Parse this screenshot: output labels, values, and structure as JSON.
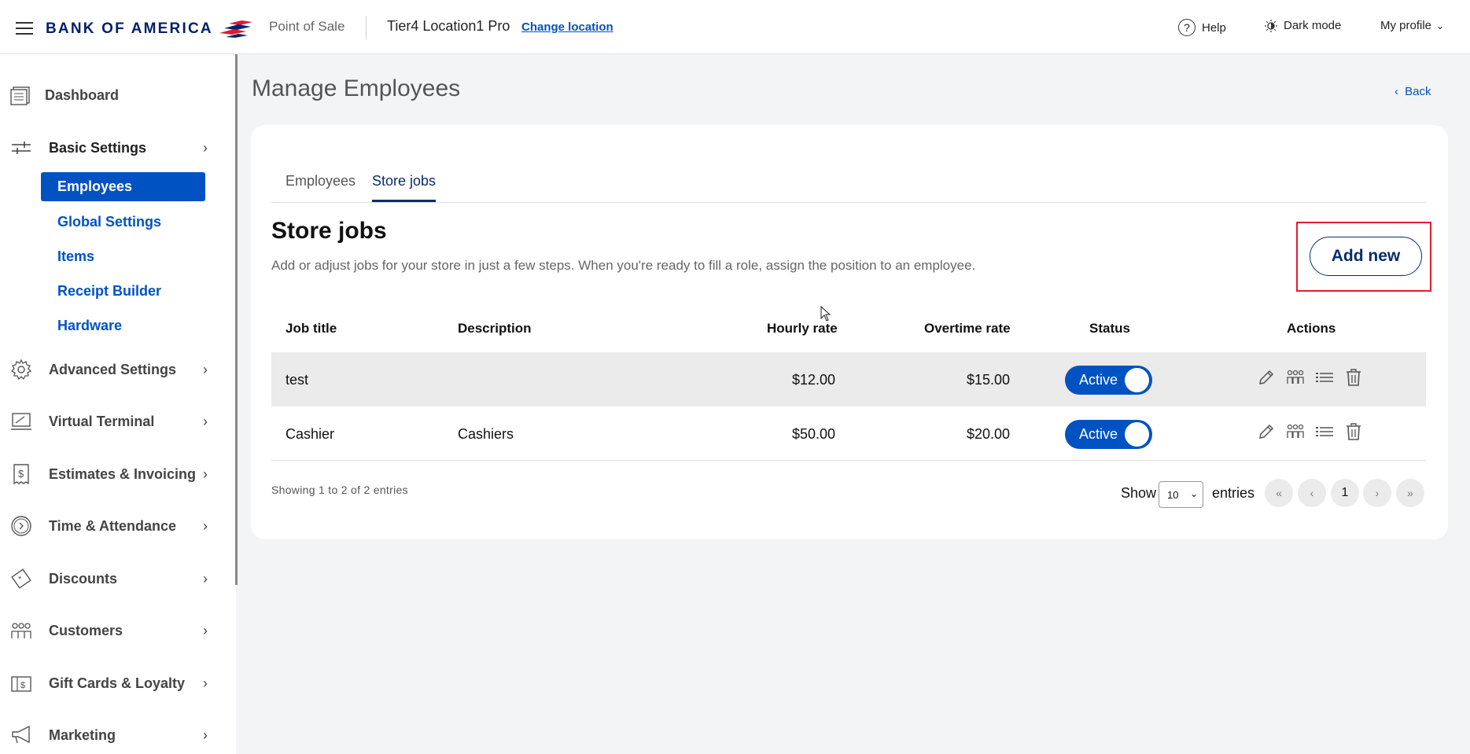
{
  "header": {
    "brand": "BANK OF AMERICA",
    "app_name": "Point of Sale",
    "location": "Tier4 Location1 Pro",
    "change_location": "Change location",
    "help": "Help",
    "dark_mode": "Dark mode",
    "profile": "My profile"
  },
  "sidebar": {
    "items": [
      {
        "label": "Dashboard",
        "icon": "dashboard-icon"
      },
      {
        "label": "Basic Settings",
        "icon": "sliders-icon"
      },
      {
        "label": "Advanced Settings",
        "icon": "gear-icon"
      },
      {
        "label": "Virtual Terminal",
        "icon": "terminal-icon"
      },
      {
        "label": "Estimates & Invoicing",
        "icon": "invoice-icon"
      },
      {
        "label": "Time & Attendance",
        "icon": "clock-icon"
      },
      {
        "label": "Discounts",
        "icon": "tag-icon"
      },
      {
        "label": "Customers",
        "icon": "people-icon"
      },
      {
        "label": "Gift Cards & Loyalty",
        "icon": "gift-card-icon"
      },
      {
        "label": "Marketing",
        "icon": "megaphone-icon"
      }
    ],
    "sub_items": [
      "Employees",
      "Global Settings",
      "Items",
      "Receipt Builder",
      "Hardware"
    ],
    "active_sub": "Employees"
  },
  "main": {
    "title": "Manage Employees",
    "back": "Back",
    "tabs": [
      "Employees",
      "Store jobs"
    ],
    "active_tab": "Store jobs",
    "section_title": "Store jobs",
    "section_desc": "Add or adjust jobs for your store in just a few steps. When you're ready to fill a role, assign the position to an employee.",
    "add_button": "Add new"
  },
  "table": {
    "headers": {
      "job_title": "Job title",
      "description": "Description",
      "hourly_rate": "Hourly rate",
      "overtime_rate": "Overtime rate",
      "status": "Status",
      "actions": "Actions"
    },
    "rows": [
      {
        "job_title": "test",
        "description": "",
        "hourly_rate": "$12.00",
        "overtime_rate": "$15.00",
        "status": "Active"
      },
      {
        "job_title": "Cashier",
        "description": "Cashiers",
        "hourly_rate": "$50.00",
        "overtime_rate": "$20.00",
        "status": "Active"
      }
    ]
  },
  "footer": {
    "showing": "Showing 1 to 2 of 2 entries",
    "show": "Show",
    "entries": "entries",
    "page_size": "10",
    "first": "«",
    "prev": "‹",
    "page": "1",
    "next": "›",
    "last": "»"
  },
  "colors": {
    "primary": "#0052c2",
    "navy": "#0a2c6b",
    "highlight": "#e01e2f"
  }
}
